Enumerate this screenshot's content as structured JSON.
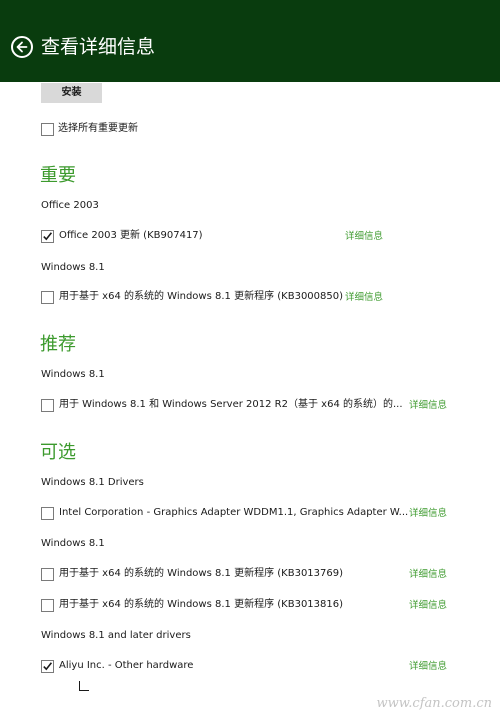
{
  "header": {
    "title": "查看详细信息",
    "back_icon": "back-arrow-circle-icon"
  },
  "toolbar": {
    "install_label": "安装"
  },
  "select_all": {
    "label": "选择所有重要更新",
    "checked": false
  },
  "sections": [
    {
      "title": "重要",
      "groups": [
        {
          "label": "Office 2003",
          "items": [
            {
              "label": "Office 2003 更新 (KB907417)",
              "checked": true,
              "detail": "详细信息"
            }
          ]
        },
        {
          "label": "Windows 8.1",
          "items": [
            {
              "label": "用于基于 x64 的系统的 Windows 8.1 更新程序 (KB3000850)",
              "checked": false,
              "detail": "详细信息"
            }
          ]
        }
      ]
    },
    {
      "title": "推荐",
      "groups": [
        {
          "label": "Windows 8.1",
          "items": [
            {
              "label": "用于 Windows 8.1 和 Windows Server 2012 R2（基于 x64 的系统）的...",
              "checked": false,
              "detail": "详细信息"
            }
          ]
        }
      ]
    },
    {
      "title": "可选",
      "groups": [
        {
          "label": "Windows 8.1 Drivers",
          "items": [
            {
              "label": "Intel Corporation - Graphics Adapter WDDM1.1, Graphics Adapter W...",
              "checked": false,
              "detail": "详细信息"
            }
          ]
        },
        {
          "label": "Windows 8.1",
          "items": [
            {
              "label": "用于基于 x64 的系统的 Windows 8.1 更新程序 (KB3013769)",
              "checked": false,
              "detail": "详细信息"
            },
            {
              "label": "用于基于 x64 的系统的 Windows 8.1 更新程序 (KB3013816)",
              "checked": false,
              "detail": "详细信息"
            }
          ]
        },
        {
          "label": "Windows 8.1 and later drivers",
          "items": [
            {
              "label": "Aliyu   Inc. - Other hardware",
              "checked": true,
              "detail": "详细信息"
            }
          ]
        }
      ]
    }
  ],
  "watermark": "www.cfan.com.cn",
  "colors": {
    "header_bg": "#093c0e",
    "accent_green": "#3c9a2d",
    "button_bg": "#d9d9d9"
  }
}
